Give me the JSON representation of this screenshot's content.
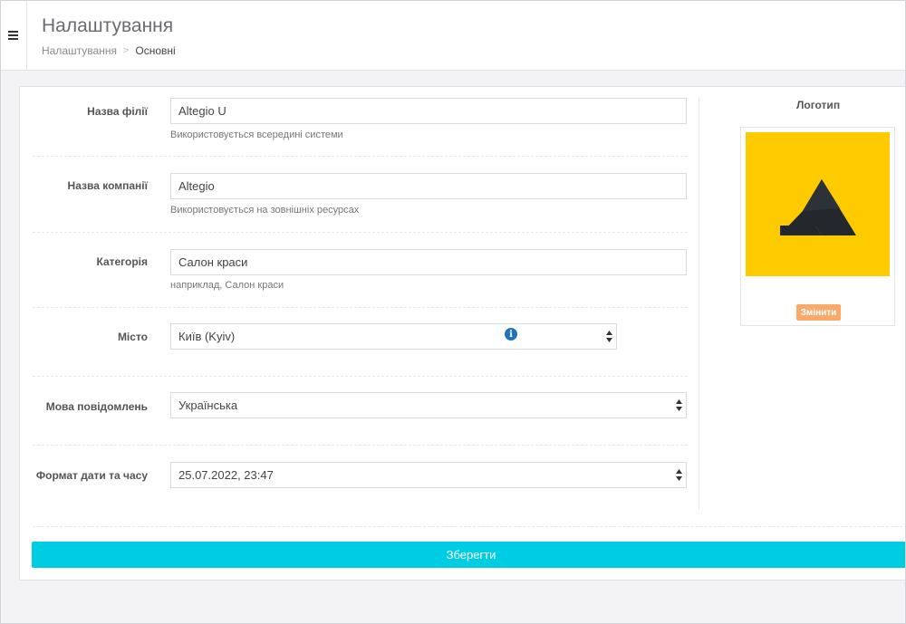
{
  "header": {
    "title": "Налаштування",
    "breadcrumb": [
      {
        "label": "Налаштування"
      },
      {
        "label": "Основні"
      }
    ],
    "breadcrumb_separator": ">"
  },
  "form": {
    "branch_name": {
      "label": "Назва філії",
      "value": "Altegio U",
      "hint": "Використовується всередині системи"
    },
    "company_name": {
      "label": "Назва компанії",
      "value": "Altegio",
      "hint": "Використовується на зовнішніх ресурсах"
    },
    "category": {
      "label": "Категорія",
      "value": "Салон краси",
      "hint": "наприклад, Салон краси"
    },
    "city": {
      "label": "Місто",
      "value": "Київ (Kyiv)"
    },
    "notification_language": {
      "label": "Мова повідомлень",
      "value": "Українська"
    },
    "datetime_format": {
      "label": "Формат дати та часу",
      "value": "25.07.2022, 23:47"
    }
  },
  "logo": {
    "title": "Логотип",
    "change_label": "Змінити",
    "background_color": "#fdcb00",
    "mark_color": "#23282d"
  },
  "actions": {
    "save_label": "Зберегти"
  },
  "colors": {
    "accent": "#00cde3",
    "change_button": "#f9a96a",
    "info_icon": "#1e73be"
  },
  "icons": {
    "menu": "hamburger-icon",
    "info": "info-icon",
    "select": "select-arrows-icon"
  }
}
